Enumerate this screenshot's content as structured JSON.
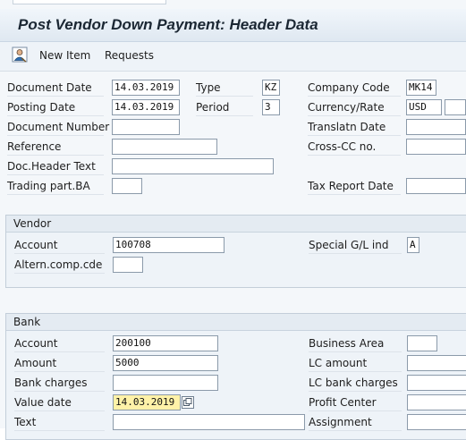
{
  "title": "Post Vendor Down Payment: Header Data",
  "toolbar": {
    "new_item": "New Item",
    "requests": "Requests"
  },
  "header": {
    "document_date": {
      "label": "Document Date",
      "value": "14.03.2019"
    },
    "type": {
      "label": "Type",
      "value": "KZ"
    },
    "company_code": {
      "label": "Company Code",
      "value": "MK14"
    },
    "posting_date": {
      "label": "Posting Date",
      "value": "14.03.2019"
    },
    "period": {
      "label": "Period",
      "value": "3"
    },
    "currency_rate": {
      "label": "Currency/Rate",
      "value": "USD",
      "rate": ""
    },
    "document_number": {
      "label": "Document Number",
      "value": ""
    },
    "translatn_date": {
      "label": "Translatn Date",
      "value": ""
    },
    "reference": {
      "label": "Reference",
      "value": ""
    },
    "cross_cc": {
      "label": "Cross-CC no.",
      "value": ""
    },
    "doc_header_text": {
      "label": "Doc.Header Text",
      "value": ""
    },
    "trading_part": {
      "label": "Trading part.BA",
      "value": ""
    },
    "tax_report_date": {
      "label": "Tax Report Date",
      "value": ""
    }
  },
  "vendor": {
    "title": "Vendor",
    "account": {
      "label": "Account",
      "value": "100708"
    },
    "special_gl": {
      "label": "Special G/L ind",
      "value": "A"
    },
    "altern_comp": {
      "label": "Altern.comp.cde",
      "value": ""
    }
  },
  "bank": {
    "title": "Bank",
    "account": {
      "label": "Account",
      "value": "200100"
    },
    "business_area": {
      "label": "Business Area",
      "value": ""
    },
    "amount": {
      "label": "Amount",
      "value": "5000"
    },
    "lc_amount": {
      "label": "LC amount",
      "value": ""
    },
    "bank_charges": {
      "label": "Bank charges",
      "value": ""
    },
    "lc_bank_charges": {
      "label": "LC bank charges",
      "value": ""
    },
    "value_date": {
      "label": "Value date",
      "value": "14.03.2019"
    },
    "profit_center": {
      "label": "Profit Center",
      "value": ""
    },
    "text": {
      "label": "Text",
      "value": ""
    },
    "assignment": {
      "label": "Assignment",
      "value": ""
    }
  },
  "icons": {
    "new_item": "person-list-icon",
    "value_help": "value-help-icon"
  },
  "colors": {
    "selected_field": "#fff2a8",
    "group_background": "#eef3f8"
  }
}
